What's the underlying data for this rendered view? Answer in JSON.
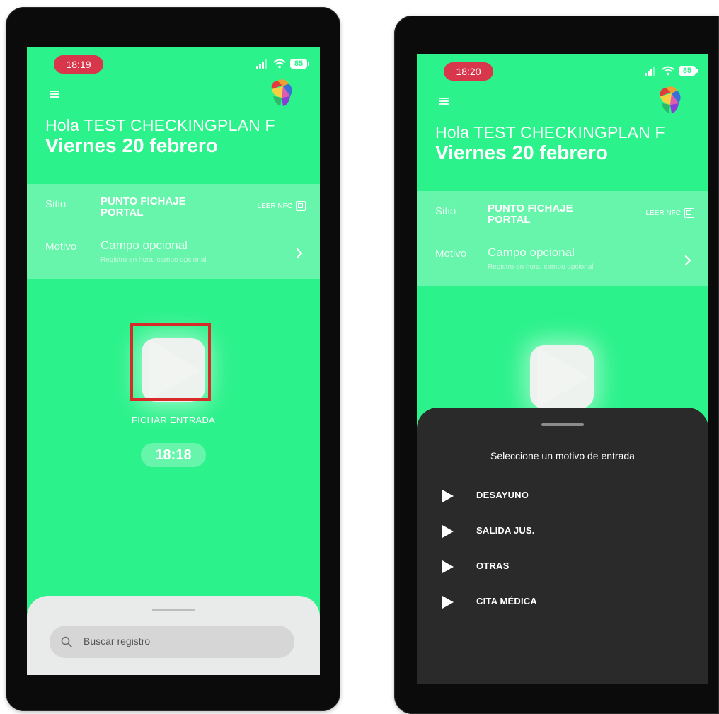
{
  "colors": {
    "app_green": "#2cf28b",
    "highlight": "#d92a2a",
    "dark_sheet": "#2a2a2b",
    "time_pill": "#d7364b"
  },
  "left_screen": {
    "status_time": "18:19",
    "battery": "85",
    "greeting": "Hola TEST CHECKINGPLAN F",
    "date": "Viernes 20 febrero",
    "site_label": "Sitio",
    "site_value": "PUNTO FICHAJE PORTAL",
    "nfc_label": "LEER NFC",
    "reason_label": "Motivo",
    "reason_value": "Campo opcional",
    "reason_hint": "Registro en hora, campo opcional",
    "action_label": "FICHAR ENTRADA",
    "clock": "18:18",
    "search_placeholder": "Buscar registro"
  },
  "right_screen": {
    "status_time": "18:20",
    "battery": "85",
    "greeting": "Hola TEST CHECKINGPLAN F",
    "date": "Viernes 20 febrero",
    "site_label": "Sitio",
    "site_value": "PUNTO FICHAJE PORTAL",
    "nfc_label": "LEER NFC",
    "reason_label": "Motivo",
    "reason_value": "Campo opcional",
    "reason_hint": "Registro en hora, campo opcional",
    "sheet_title": "Seleccione un motivo de entrada",
    "options": [
      {
        "label": "DESAYUNO",
        "icon": "play-icon"
      },
      {
        "label": "SALIDA JUS.",
        "icon": "play-icon"
      },
      {
        "label": "OTRAS",
        "icon": "play-icon"
      },
      {
        "label": "CITA MÉDICA",
        "icon": "play-icon"
      }
    ]
  }
}
